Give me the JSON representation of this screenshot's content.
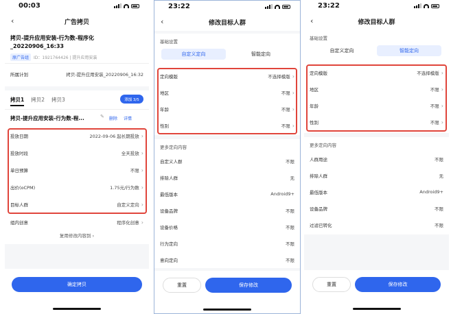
{
  "phone1": {
    "time": "00:03",
    "title": "广告拷贝",
    "ad_name": "拷贝-提升应用安装-行为数-程序化_20220906_16:33",
    "tag": "原广告组",
    "id_line": "ID：1921764426  |  提升应用安装",
    "plan_label": "所属计划",
    "plan_value": "拷贝-提升应用安装_20220906_16:32",
    "tabs": [
      "拷贝1",
      "拷贝2",
      "拷贝3"
    ],
    "add_button": "添加 3/5",
    "copy_name": "拷贝-提升应用安装-行为数-程...",
    "delete": "删除",
    "detail": "详情",
    "rows": [
      {
        "label": "投放日期",
        "value": "2022-09-06 起长期投放"
      },
      {
        "label": "投放时段",
        "value": "全天投放"
      },
      {
        "label": "单日预算",
        "value": "不限"
      },
      {
        "label": "出价(oCPM)",
        "value": "1.75元/行为数"
      },
      {
        "label": "目标人群",
        "value": "自定义定向"
      }
    ],
    "creative_label": "组内创意",
    "creative_value": "程序化创意",
    "reuse_link": "复用修改内容到",
    "confirm_button": "确定拷贝"
  },
  "phone2": {
    "time": "23:22",
    "title": "修改目标人群",
    "basic_settings": "基础设置",
    "seg_left": "自定义定向",
    "seg_right": "智能定向",
    "rows": [
      {
        "label": "定向模版",
        "value": "不选择模版"
      },
      {
        "label": "地区",
        "value": "不限"
      },
      {
        "label": "年龄",
        "value": "不限"
      },
      {
        "label": "性别",
        "value": "不限"
      }
    ],
    "more": "更多定向内容",
    "more_rows": [
      {
        "label": "自定义人群",
        "value": "不限"
      },
      {
        "label": "排除人群",
        "value": "无"
      },
      {
        "label": "最低版本",
        "value": "Android9+"
      },
      {
        "label": "设备品牌",
        "value": "不限"
      },
      {
        "label": "设备价格",
        "value": "不限"
      },
      {
        "label": "行为定向",
        "value": "不限"
      },
      {
        "label": "意向定向",
        "value": "不限"
      }
    ],
    "reset": "重置",
    "save": "保存修改"
  },
  "phone3": {
    "time": "23:22",
    "title": "修改目标人群",
    "basic_settings": "基础设置",
    "seg_left": "自定义定向",
    "seg_right": "智能定向",
    "rows": [
      {
        "label": "定向模版",
        "value": "不选择模版"
      },
      {
        "label": "地区",
        "value": "不限"
      },
      {
        "label": "年龄",
        "value": "不限"
      },
      {
        "label": "性别",
        "value": "不限"
      }
    ],
    "more": "更多定向内容",
    "more_rows": [
      {
        "label": "人群用途",
        "value": "不限"
      },
      {
        "label": "排除人群",
        "value": "无"
      },
      {
        "label": "最低版本",
        "value": "Android9+"
      },
      {
        "label": "设备品牌",
        "value": "不限"
      },
      {
        "label": "过滤已转化",
        "value": "不限"
      }
    ],
    "reset": "重置",
    "save": "保存修改"
  },
  "colors": {
    "accent": "#2f66ed",
    "highlight": "#e0443a",
    "background": "#f5f6f8"
  },
  "icons": [
    "back-icon",
    "chevron-right-icon",
    "signal-icon",
    "wifi-icon",
    "battery-icon",
    "edit-icon"
  ]
}
